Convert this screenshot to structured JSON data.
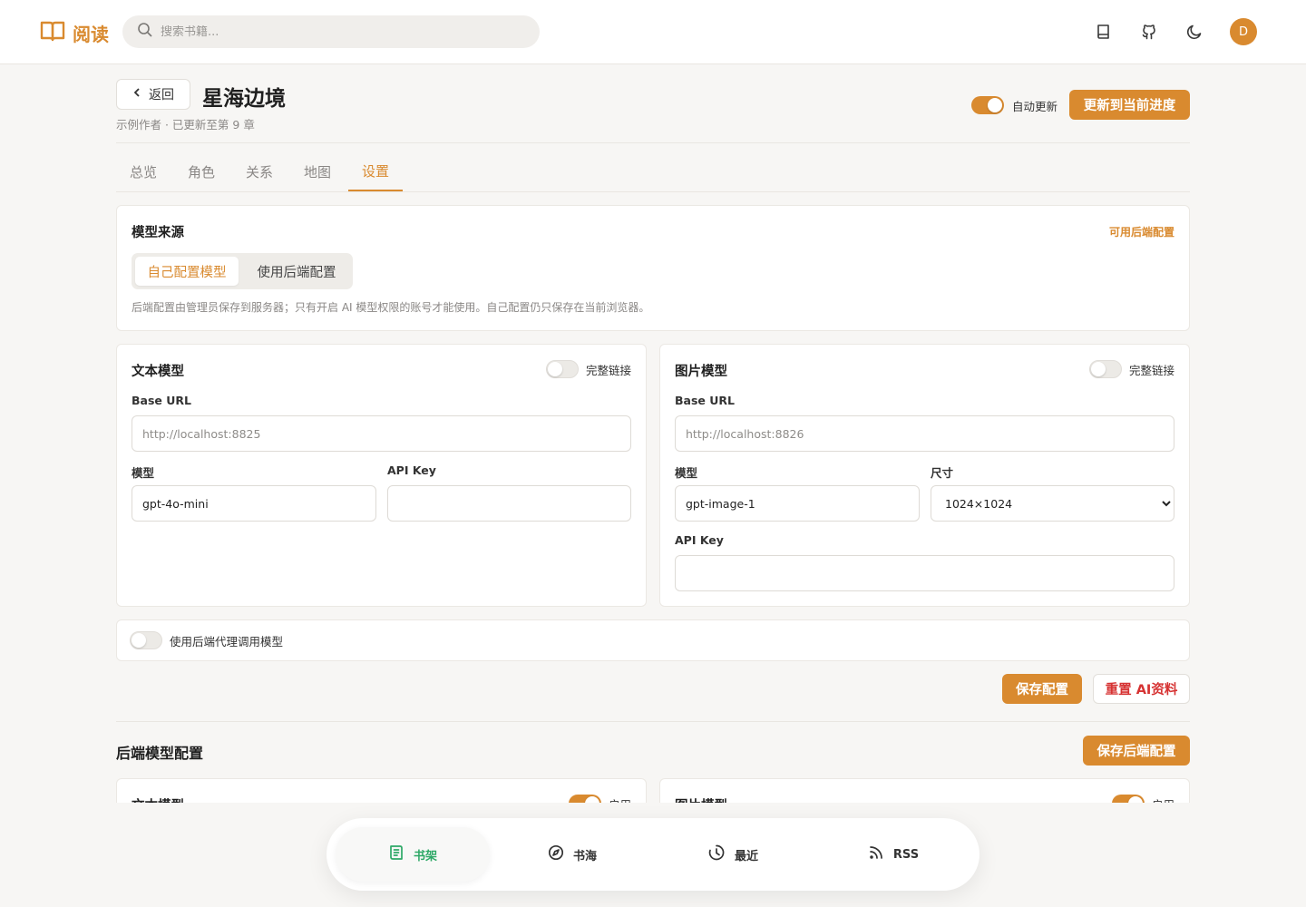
{
  "app": {
    "logo_text": "阅读",
    "avatar_initial": "D"
  },
  "search": {
    "placeholder": "搜索书籍..."
  },
  "topbar_icons": [
    "book-icon",
    "github-icon",
    "moon-icon"
  ],
  "header": {
    "back_label": "返回",
    "title": "星海边境",
    "meta": "示例作者 · 已更新至第 9 章",
    "auto_update_label": "自动更新",
    "auto_update_on": true,
    "update_button": "更新到当前进度"
  },
  "tabs": [
    {
      "label": "总览",
      "active": false
    },
    {
      "label": "角色",
      "active": false
    },
    {
      "label": "关系",
      "active": false
    },
    {
      "label": "地图",
      "active": false
    },
    {
      "label": "设置",
      "active": true
    }
  ],
  "model_source": {
    "title": "模型来源",
    "link": "可用后端配置",
    "options": [
      {
        "label": "自己配置模型",
        "active": true
      },
      {
        "label": "使用后端配置",
        "active": false
      }
    ],
    "help": "后端配置由管理员保存到服务器；只有开启 AI 模型权限的账号才能使用。自己配置仍只保存在当前浏览器。"
  },
  "text_model": {
    "title": "文本模型",
    "toggle_label": "完整链接",
    "toggle_on": false,
    "base_url_label": "Base URL",
    "base_url_placeholder": "http://localhost:8825",
    "model_label": "模型",
    "model_value": "gpt-4o-mini",
    "api_key_label": "API Key",
    "api_key_value": ""
  },
  "image_model": {
    "title": "图片模型",
    "toggle_label": "完整链接",
    "toggle_on": false,
    "base_url_label": "Base URL",
    "base_url_placeholder": "http://localhost:8826",
    "model_label": "模型",
    "model_value": "gpt-image-1",
    "size_label": "尺寸",
    "size_value": "1024×1024",
    "api_key_label": "API Key",
    "api_key_value": ""
  },
  "proxy": {
    "label": "使用后端代理调用模型",
    "on": false
  },
  "actions": {
    "save": "保存配置",
    "reset": "重置 AI资料"
  },
  "backend": {
    "title": "后端模型配置",
    "save": "保存后端配置",
    "text_title": "文本模型",
    "image_title": "图片模型",
    "enable_label": "启用"
  },
  "bottom_nav": [
    {
      "label": "书架",
      "icon": "shelf-icon",
      "active": true
    },
    {
      "label": "书海",
      "icon": "compass-icon",
      "active": false
    },
    {
      "label": "最近",
      "icon": "history-icon",
      "active": false
    },
    {
      "label": "RSS",
      "icon": "rss-icon",
      "active": false
    }
  ],
  "colors": {
    "accent": "#d98a2f",
    "nav_active": "#2da866",
    "danger": "#d63232"
  }
}
